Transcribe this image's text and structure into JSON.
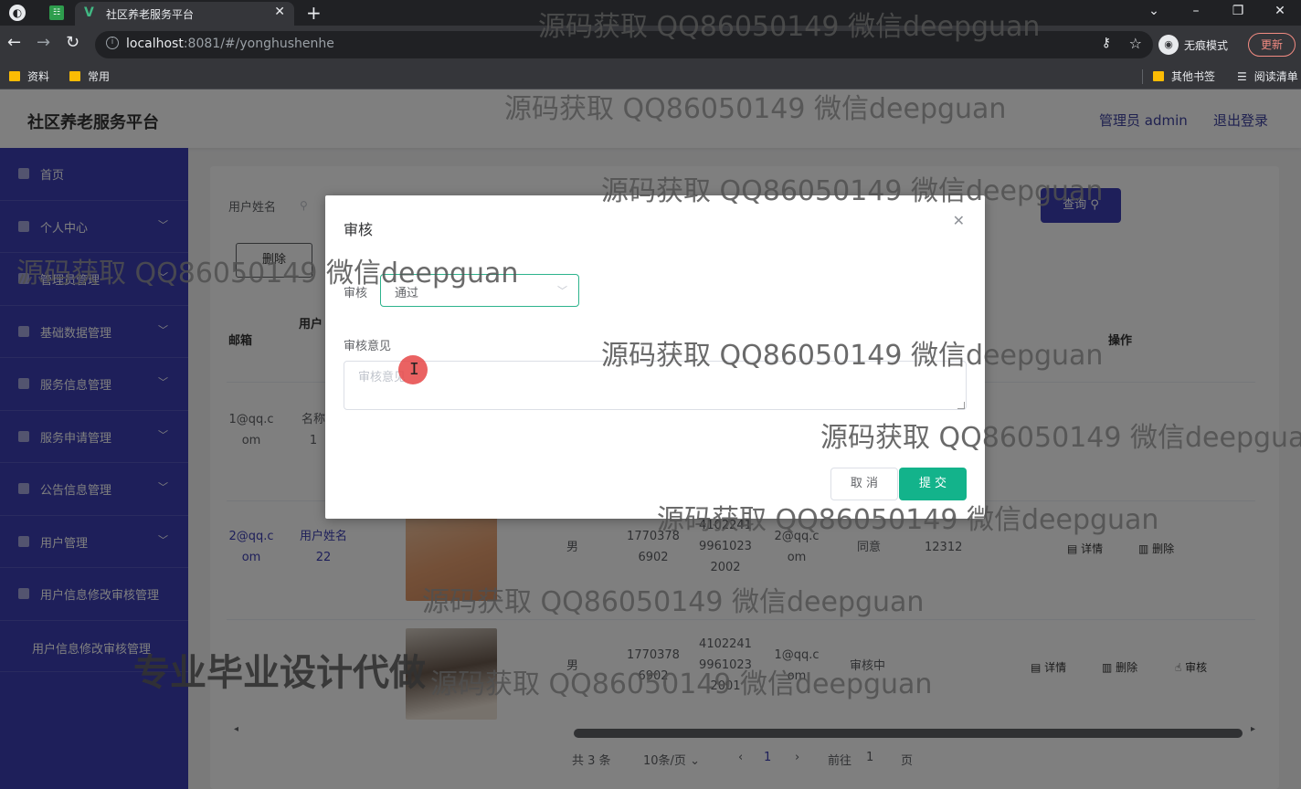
{
  "browser": {
    "tab_title": "社区养老服务平台",
    "url_host": "localhost",
    "url_rest": ":8081/#/yonghushenhe",
    "incognito_label": "无痕模式",
    "update_label": "更新",
    "bookmarks": [
      "资料",
      "常用"
    ],
    "bookmarks_right": [
      "其他书签",
      "阅读清单"
    ]
  },
  "app": {
    "title": "社区养老服务平台",
    "user": "管理员 admin",
    "logout": "退出登录"
  },
  "sidebar": {
    "items": [
      {
        "label": "首页"
      },
      {
        "label": "个人中心"
      },
      {
        "label": "管理员管理"
      },
      {
        "label": "基础数据管理"
      },
      {
        "label": "服务信息管理"
      },
      {
        "label": "服务申请管理"
      },
      {
        "label": "公告信息管理"
      },
      {
        "label": "用户管理"
      },
      {
        "label": "用户信息修改审核管理"
      }
    ],
    "sub_item": "用户信息修改审核管理"
  },
  "search": {
    "label": "用户姓名",
    "query_button": "查询",
    "delete_button": "删除"
  },
  "table": {
    "headers": {
      "email": "邮箱",
      "name": "用户",
      "op": "操作"
    },
    "row1": {
      "email": "1@qq.c om",
      "name": "名称 1"
    },
    "row2": {
      "email": "2@qq.c om",
      "name": "用户姓名 22",
      "gender": "男",
      "phone": "1770378 6902",
      "id": "4102241 9961023 2002",
      "email2": "2@qq.c om",
      "status": "同意",
      "opinion": "12312",
      "op_detail": "详情",
      "op_delete": "删除"
    },
    "row3": {
      "email": "",
      "name": "",
      "gender": "男",
      "phone": "1770378 6902",
      "id": "4102241 9961023 2001",
      "email2": "1@qq.c om",
      "status": "审核中",
      "op_detail": "详情",
      "op_delete": "删除",
      "op_audit": "审核"
    }
  },
  "pagination": {
    "total": "共 3 条",
    "page_size": "10条/页",
    "current": "1",
    "goto_label": "前往",
    "goto_value": "1",
    "page_suffix": "页"
  },
  "dialog": {
    "title": "审核",
    "audit_label": "审核",
    "audit_value": "通过",
    "opinion_label": "审核意见",
    "opinion_placeholder": "审核意见",
    "cancel": "取 消",
    "submit": "提 交"
  },
  "watermark": {
    "text": "源码获取 QQ86050149 微信deepguan",
    "strong": "专业毕业设计代做"
  },
  "colors": {
    "sidebar": "#3d3fb5",
    "accent": "#13b38b",
    "primary": "#3d3fb5"
  }
}
